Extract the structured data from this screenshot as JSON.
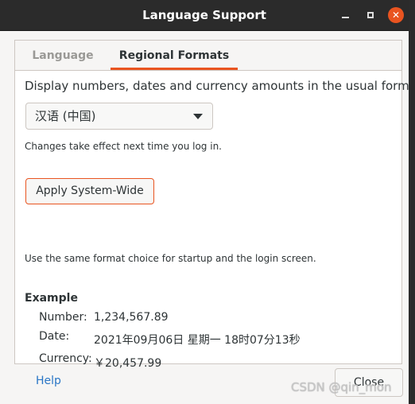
{
  "window": {
    "title": "Language Support",
    "controls": {
      "minimize_icon": "minimize-icon",
      "maximize_icon": "maximize-icon",
      "close_glyph": "✕"
    }
  },
  "tabs": [
    {
      "label": "Language",
      "active": false
    },
    {
      "label": "Regional Formats",
      "active": true
    }
  ],
  "regional": {
    "description": "Display numbers, dates and currency amounts in the usual format for:",
    "format_select": {
      "value": "汉语 (中国)"
    },
    "change_note": "Changes take effect next time you log in.",
    "apply_button": "Apply System-Wide",
    "apply_note": "Use the same format choice for startup and the login screen."
  },
  "example": {
    "heading": "Example",
    "number_label": "Number:",
    "number_value": "1,234,567.89",
    "date_label": "Date:",
    "date_value": "2021年09月06日 星期一 18时07分13秒",
    "currency_label": "Currency:",
    "currency_value": "￥20,457.99"
  },
  "footer": {
    "help": "Help",
    "close": "Close"
  },
  "watermark": "CSDN @qin_mon",
  "colors": {
    "accent": "#e95420",
    "titlebar": "#2b2b2b",
    "link": "#2a76c6"
  }
}
